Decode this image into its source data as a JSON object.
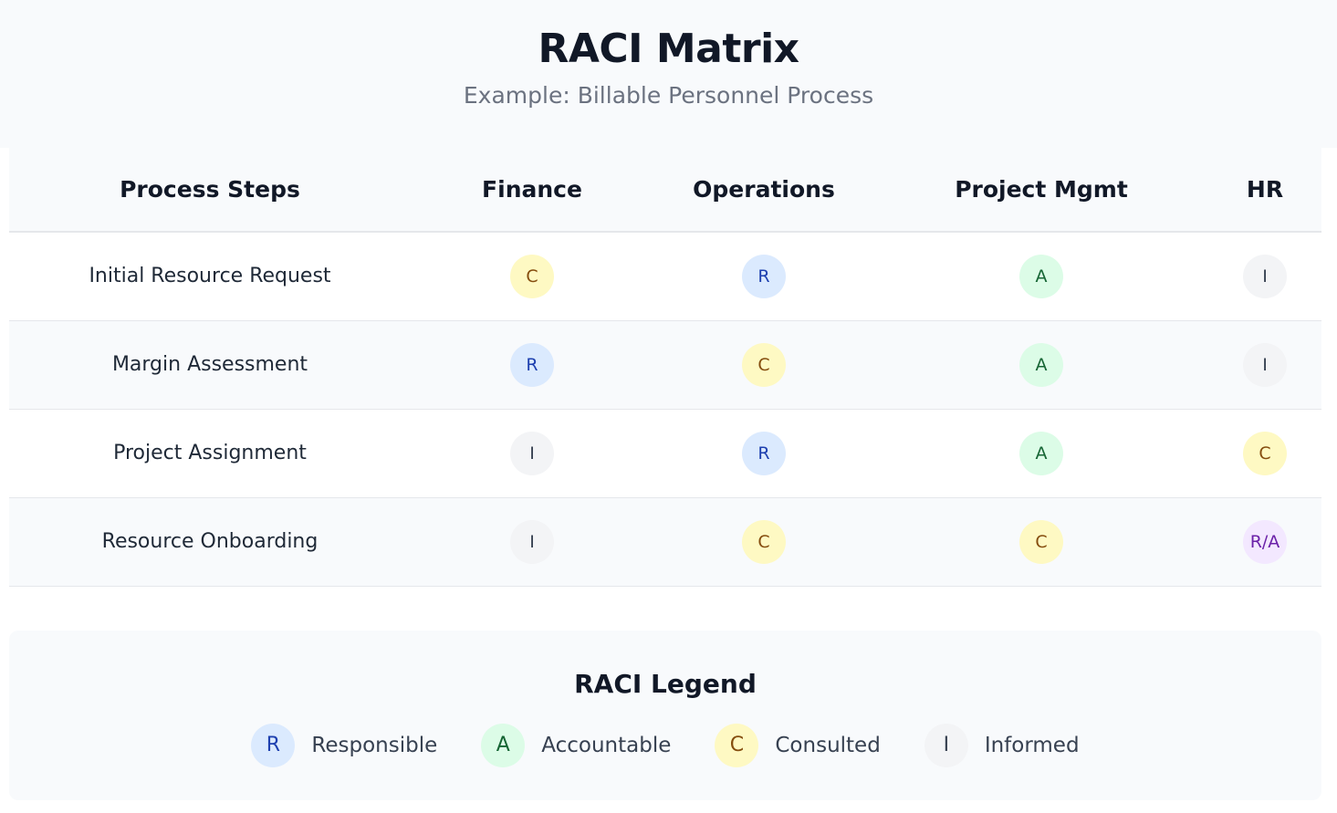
{
  "header": {
    "title": "RACI Matrix",
    "subtitle": "Example: Billable Personnel Process"
  },
  "columns": [
    "Process Steps",
    "Finance",
    "Operations",
    "Project Mgmt",
    "HR"
  ],
  "rows": [
    {
      "step": "Initial Resource Request",
      "roles": [
        "C",
        "R",
        "A",
        "I"
      ]
    },
    {
      "step": "Margin Assessment",
      "roles": [
        "R",
        "C",
        "A",
        "I"
      ]
    },
    {
      "step": "Project Assignment",
      "roles": [
        "I",
        "R",
        "A",
        "C"
      ]
    },
    {
      "step": "Resource Onboarding",
      "roles": [
        "I",
        "C",
        "C",
        "R/A"
      ]
    }
  ],
  "legend": {
    "title": "RACI Legend",
    "items": [
      {
        "code": "R",
        "label": "Responsible"
      },
      {
        "code": "A",
        "label": "Accountable"
      },
      {
        "code": "C",
        "label": "Consulted"
      },
      {
        "code": "I",
        "label": "Informed"
      }
    ]
  },
  "colors": {
    "R": "#dbeafe",
    "A": "#dcfce7",
    "C": "#fef9c3",
    "I": "#f3f4f6",
    "R/A": "#f3e8ff"
  }
}
